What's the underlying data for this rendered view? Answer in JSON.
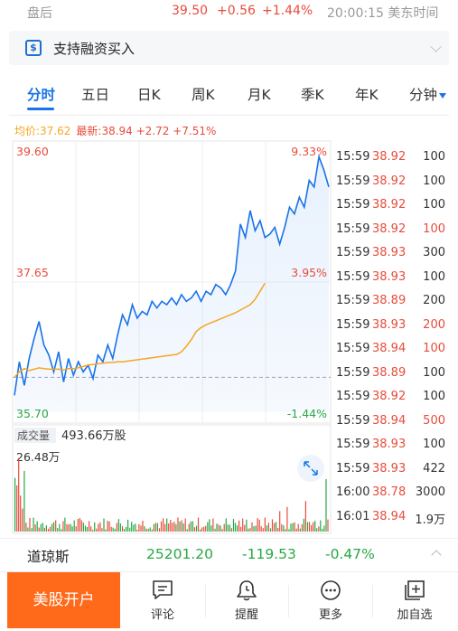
{
  "after_hours": {
    "label": "盘后",
    "price": "39.50",
    "change": "+0.56",
    "change_pct": "+1.44%",
    "time": "20:00:15 美东时间"
  },
  "margin": {
    "icon": "dollar-icon",
    "icon_glyph": "$",
    "text": "支持融资买入"
  },
  "tabs": [
    {
      "label": "分时",
      "active": true
    },
    {
      "label": "五日"
    },
    {
      "label": "日K"
    },
    {
      "label": "周K"
    },
    {
      "label": "月K"
    },
    {
      "label": "季K"
    },
    {
      "label": "年K"
    },
    {
      "label": "分钟"
    }
  ],
  "legend": {
    "avg": "均价:37.62",
    "latest": "最新:38.94 +2.72 +7.51%"
  },
  "chart_data": {
    "type": "line",
    "y_high": "39.60",
    "y_mid": "37.65",
    "y_low": "35.70",
    "pct_high": "9.33%",
    "pct_mid": "3.95%",
    "pct_low": "-1.44%",
    "ylim": [
      35.7,
      39.6
    ],
    "prev_close": 36.22,
    "series": [
      {
        "values": [
          35.95,
          36.45,
          36.1,
          36.5,
          36.8,
          37.05,
          36.7,
          36.55,
          36.3,
          36.6,
          36.15,
          36.5,
          36.25,
          36.45,
          36.3,
          36.4,
          36.2,
          36.55,
          36.45,
          36.7,
          36.5,
          36.85,
          37.15,
          37.0,
          37.3,
          37.1,
          37.2,
          37.15,
          37.35,
          37.25,
          37.35,
          37.3,
          37.4,
          37.3,
          37.45,
          37.35,
          37.4,
          37.5,
          37.35,
          37.5,
          37.45,
          37.6,
          37.55,
          37.45,
          37.6,
          37.8,
          38.5,
          38.3,
          38.7,
          38.4,
          38.55,
          38.3,
          38.35,
          38.45,
          38.2,
          38.45,
          38.75,
          38.65,
          38.9,
          38.75,
          39.15,
          39.05,
          39.5,
          39.3,
          39.05
        ]
      },
      {
        "values": [
          36.22,
          36.3,
          36.35,
          36.32,
          36.34,
          36.36,
          36.35,
          36.34,
          36.34,
          36.34,
          36.33,
          36.35,
          36.35,
          36.36,
          36.38,
          36.4,
          36.41,
          36.42,
          36.43,
          36.44,
          36.44,
          36.45,
          36.45,
          36.46,
          36.47,
          36.48,
          36.49,
          36.5,
          36.51,
          36.52,
          36.53,
          36.54,
          36.55,
          36.56,
          36.6,
          36.68,
          36.78,
          36.9,
          36.96,
          37.0,
          37.03,
          37.06,
          37.09,
          37.12,
          37.15,
          37.18,
          37.22,
          37.26,
          37.3,
          37.38,
          37.5,
          37.62
        ]
      }
    ],
    "volume": {
      "label": "成交量",
      "total": "493.66万股",
      "max_label": "26.48万"
    }
  },
  "ticks": [
    {
      "time": "15:59",
      "price": "38.92",
      "vol": "100",
      "price_color": "#e74c3c",
      "vol_color": "#333333"
    },
    {
      "time": "15:59",
      "price": "38.92",
      "vol": "100",
      "price_color": "#e74c3c",
      "vol_color": "#333333"
    },
    {
      "time": "15:59",
      "price": "38.92",
      "vol": "100",
      "price_color": "#e74c3c",
      "vol_color": "#333333"
    },
    {
      "time": "15:59",
      "price": "38.92",
      "vol": "100",
      "price_color": "#e74c3c",
      "vol_color": "#e74c3c"
    },
    {
      "time": "15:59",
      "price": "38.93",
      "vol": "300",
      "price_color": "#e74c3c",
      "vol_color": "#333333"
    },
    {
      "time": "15:59",
      "price": "38.93",
      "vol": "100",
      "price_color": "#e74c3c",
      "vol_color": "#333333"
    },
    {
      "time": "15:59",
      "price": "38.89",
      "vol": "200",
      "price_color": "#e74c3c",
      "vol_color": "#333333"
    },
    {
      "time": "15:59",
      "price": "38.93",
      "vol": "200",
      "price_color": "#e74c3c",
      "vol_color": "#e74c3c"
    },
    {
      "time": "15:59",
      "price": "38.94",
      "vol": "100",
      "price_color": "#e74c3c",
      "vol_color": "#e74c3c"
    },
    {
      "time": "15:59",
      "price": "38.89",
      "vol": "100",
      "price_color": "#e74c3c",
      "vol_color": "#333333"
    },
    {
      "time": "15:59",
      "price": "38.92",
      "vol": "100",
      "price_color": "#e74c3c",
      "vol_color": "#333333"
    },
    {
      "time": "15:59",
      "price": "38.94",
      "vol": "500",
      "price_color": "#e74c3c",
      "vol_color": "#e74c3c"
    },
    {
      "time": "15:59",
      "price": "38.93",
      "vol": "100",
      "price_color": "#e74c3c",
      "vol_color": "#333333"
    },
    {
      "time": "15:59",
      "price": "38.93",
      "vol": "422",
      "price_color": "#e74c3c",
      "vol_color": "#333333"
    },
    {
      "time": "16:00",
      "price": "38.78",
      "vol": "3000",
      "price_color": "#e74c3c",
      "vol_color": "#333333"
    },
    {
      "time": "16:01",
      "price": "38.94",
      "vol": "1.9万",
      "price_color": "#e74c3c",
      "vol_color": "#333333"
    }
  ],
  "index": {
    "name": "道琼斯",
    "value": "25201.20",
    "change": "-119.53",
    "change_pct": "-0.47%"
  },
  "bottom_nav": {
    "open_account": "美股开户",
    "items": [
      {
        "label": "评论",
        "icon": "comment-icon"
      },
      {
        "label": "提醒",
        "icon": "bell-icon"
      },
      {
        "label": "更多",
        "icon": "more-icon"
      },
      {
        "label": "加自选",
        "icon": "add-watchlist-icon"
      }
    ]
  },
  "colors": {
    "up": "#e74c3c",
    "down": "#27a844",
    "price_line": "#1a73e8",
    "avg_line": "#f5a623",
    "brand": "#ff6a1a"
  }
}
